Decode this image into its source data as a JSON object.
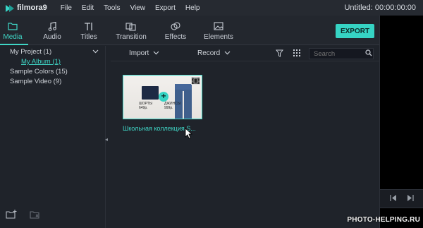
{
  "app": {
    "name": "filmora9",
    "project_title": "Untitled:",
    "timecode": "00:00:00:00"
  },
  "menu": [
    "File",
    "Edit",
    "Tools",
    "View",
    "Export",
    "Help"
  ],
  "tabs": [
    {
      "label": "Media",
      "icon": "folder-icon",
      "active": true
    },
    {
      "label": "Audio",
      "icon": "music-note-icon",
      "active": false
    },
    {
      "label": "Titles",
      "icon": "text-icon",
      "active": false
    },
    {
      "label": "Transition",
      "icon": "transition-icon",
      "active": false
    },
    {
      "label": "Effects",
      "icon": "effects-icon",
      "active": false
    },
    {
      "label": "Elements",
      "icon": "image-icon",
      "active": false
    }
  ],
  "export_label": "EXPORT",
  "sidebar": {
    "items": [
      {
        "label": "My Project (1)",
        "level": 0
      },
      {
        "label": "My Album (1)",
        "level": 1
      },
      {
        "label": "Sample Colors (15)",
        "level": 0
      },
      {
        "label": "Sample Video (9)",
        "level": 0
      }
    ]
  },
  "toolbar": {
    "import_label": "Import",
    "record_label": "Record",
    "search_placeholder": "Search"
  },
  "media": {
    "caption": "Школьная коллекция S...",
    "price_left": "ШОРТЫ\n649р.",
    "price_right": "ДЖИНСЫ\n999р."
  },
  "watermark": "PHOTO-HELPING.RU",
  "colors": {
    "accent": "#36d4c4",
    "background": "#1e2229",
    "preview_bg": "#000000"
  }
}
